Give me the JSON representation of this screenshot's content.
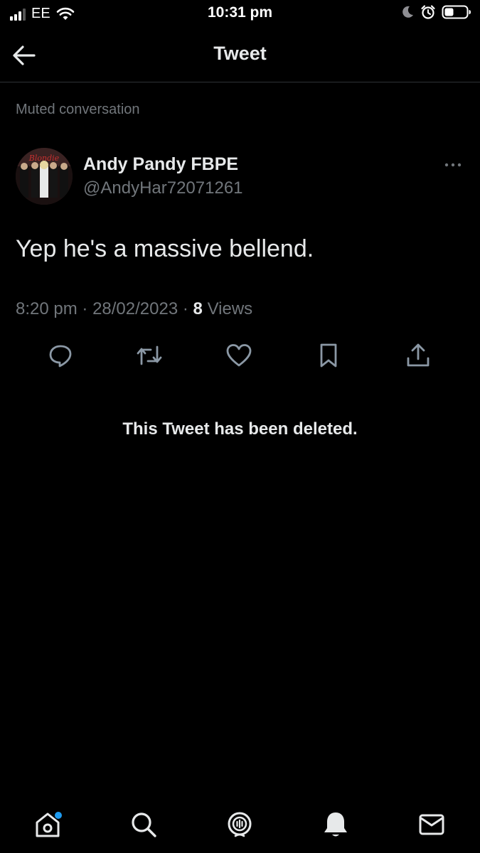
{
  "status_bar": {
    "carrier": "EE",
    "time": "10:31 pm"
  },
  "header": {
    "title": "Tweet"
  },
  "muted_label": "Muted conversation",
  "author": {
    "name": "Andy Pandy FBPE",
    "handle": "@AndyHar72071261",
    "avatar_lettering": "Blondie"
  },
  "tweet": {
    "text": "Yep he's a massive bellend.",
    "time": "8:20 pm",
    "separator": "·",
    "date": "28/02/2023",
    "views_count": "8",
    "views_label": "Views"
  },
  "actions": [
    "reply-icon",
    "retweet-icon",
    "like-icon",
    "bookmark-icon",
    "share-icon"
  ],
  "deleted_message": "This Tweet has been deleted.",
  "tab_bar": {
    "items": [
      "home-icon",
      "search-icon",
      "spaces-icon",
      "notifications-icon",
      "messages-icon"
    ],
    "home_has_notification_dot": true
  },
  "colors": {
    "background": "#000000",
    "text": "#e7e9ea",
    "secondary": "#71767b",
    "accent": "#1d9bf0",
    "divider": "#2f3336"
  }
}
